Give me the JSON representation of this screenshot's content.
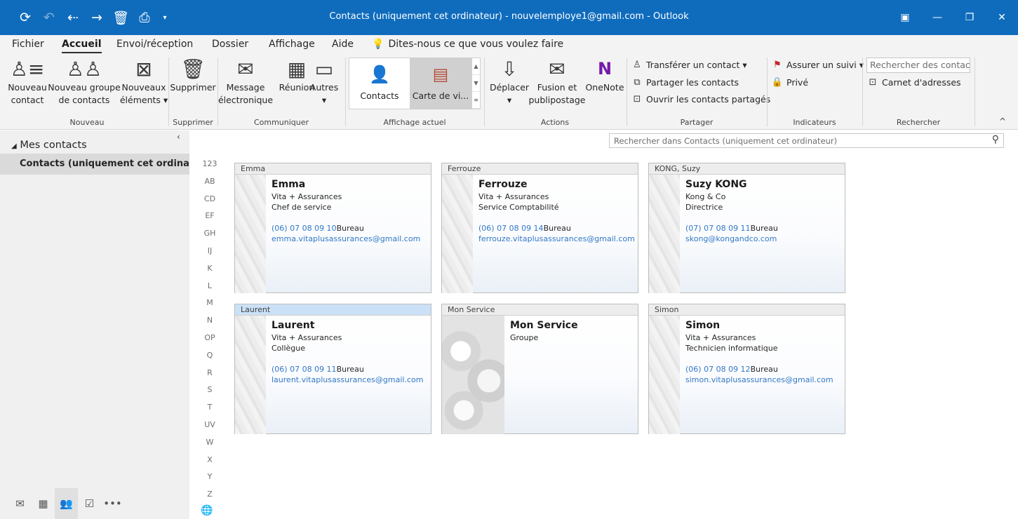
{
  "window": {
    "title": "Contacts (uniquement cet ordinateur) - nouvelemploye1@gmail.com  -  Outlook"
  },
  "qat": [
    "sync-icon",
    "undo-icon",
    "redo-icon",
    "delete-icon",
    "print-icon",
    "customize-icon"
  ],
  "menu": {
    "items": [
      "Fichier",
      "Accueil",
      "Envoi/réception",
      "Dossier",
      "Affichage",
      "Aide"
    ],
    "active": "Accueil",
    "tell_me": "Dites-nous ce que vous voulez faire"
  },
  "ribbon": {
    "nouveau": {
      "label": "Nouveau",
      "new_contact": [
        "Nouveau",
        "contact"
      ],
      "new_group": [
        "Nouveau groupe",
        "de contacts"
      ],
      "new_items": [
        "Nouveaux",
        "éléments ▾"
      ]
    },
    "supprimer": {
      "label": "Supprimer",
      "button": "Supprimer"
    },
    "communiquer": {
      "label": "Communiquer",
      "message": [
        "Message",
        "électronique"
      ],
      "meeting": "Réunion",
      "more": "Autres",
      "more_arrow": "▾"
    },
    "affichage": {
      "label": "Affichage actuel",
      "views": [
        "Contacts",
        "Carte de vi..."
      ],
      "selected": "Carte de vi..."
    },
    "actions": {
      "label": "Actions",
      "move": "Déplacer",
      "move_arrow": "▾",
      "merge": [
        "Fusion et",
        "publipostage"
      ],
      "onenote": "OneNote"
    },
    "partager": {
      "label": "Partager",
      "forward": "Transférer un contact ▾",
      "share": "Partager les contacts",
      "open_shared": "Ouvrir les contacts partagés"
    },
    "indicateurs": {
      "label": "Indicateurs",
      "follow_up": "Assurer un suivi ▾",
      "private": "Privé"
    },
    "rechercher": {
      "label": "Rechercher",
      "placeholder": "Rechercher des contacts",
      "address_book": "Carnet d'adresses"
    }
  },
  "sidebar": {
    "header": "Mes contacts",
    "folder": "Contacts (uniquement cet ordinate..."
  },
  "search": {
    "placeholder": "Rechercher dans Contacts (uniquement cet ordinateur)"
  },
  "alpha_index": [
    "123",
    "AB",
    "CD",
    "EF",
    "GH",
    "IJ",
    "K",
    "L",
    "M",
    "N",
    "OP",
    "Q",
    "R",
    "S",
    "T",
    "UV",
    "W",
    "X",
    "Y",
    "Z"
  ],
  "contacts": [
    {
      "file_as": "Emma",
      "name": "Emma",
      "company": "Vita + Assurances",
      "title": "Chef de service",
      "phone": "(06) 07 08 09 10",
      "phone_label": "Bureau",
      "email": "emma.vitaplusassurances@gmail.com"
    },
    {
      "file_as": "Ferrouze",
      "name": "Ferrouze",
      "company": "Vita + Assurances",
      "title": "Service Comptabilité",
      "phone": "(06) 07 08 09 14",
      "phone_label": "Bureau",
      "email": "ferrouze.vitaplusassurances@gmail.com"
    },
    {
      "file_as": "KONG, Suzy",
      "name": "Suzy KONG",
      "company": "Kong & Co",
      "title": "Directrice",
      "phone": "(07) 07 08 09 11",
      "phone_label": "Bureau",
      "email": "skong@kongandco.com"
    },
    {
      "file_as": "Laurent",
      "name": "Laurent",
      "company": "Vita + Assurances",
      "title": "Collègue",
      "phone": "(06) 07 08 09 11",
      "phone_label": "Bureau",
      "email": "laurent.vitaplusassurances@gmail.com"
    },
    {
      "file_as": "Mon Service",
      "name": "Mon Service",
      "company": "Groupe"
    },
    {
      "file_as": "Simon",
      "name": "Simon",
      "company": "Vita + Assurances",
      "title": "Technicien informatique",
      "phone": "(06) 07 08 09 12",
      "phone_label": "Bureau",
      "email": "simon.vitaplusassurances@gmail.com"
    }
  ],
  "colors": {
    "titlebar": "#0f6cbd",
    "link": "#3278c6",
    "selected_header": "#cbe1f7"
  }
}
